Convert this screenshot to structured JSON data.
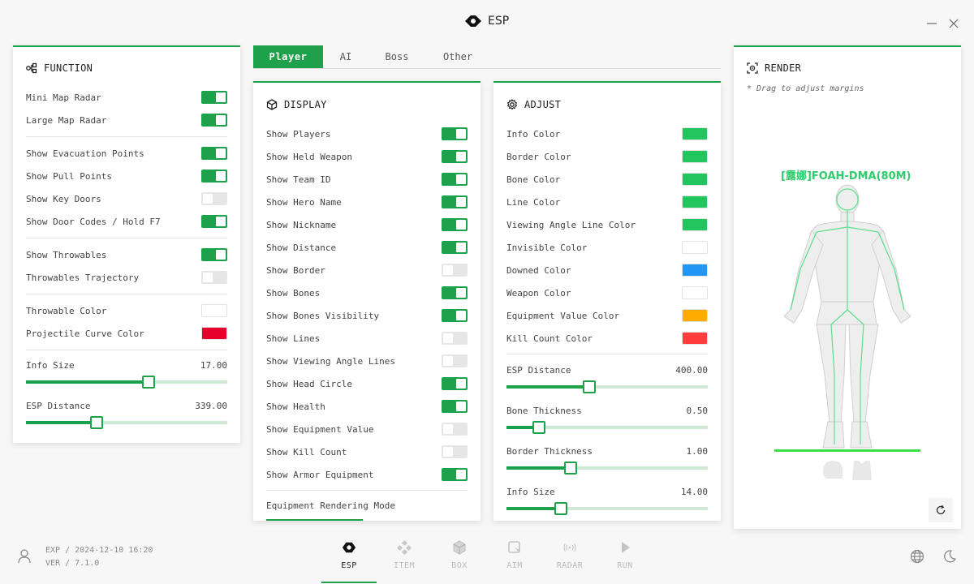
{
  "window": {
    "title": "ESP",
    "minimize_icon": "minimize-icon",
    "close_icon": "close-icon"
  },
  "colors": {
    "accent": "#1da14a",
    "track": "#cfe9d6",
    "toggle_off": "#e6e6e6"
  },
  "function_panel": {
    "title": "FUNCTION",
    "rows": [
      {
        "label": "Mini Map Radar",
        "type": "toggle",
        "on": true
      },
      {
        "label": "Large Map Radar",
        "type": "toggle",
        "on": true
      },
      {
        "label": "Show Evacuation Points",
        "type": "toggle",
        "on": true
      },
      {
        "label": "Show Pull Points",
        "type": "toggle",
        "on": true
      },
      {
        "label": "Show Key Doors",
        "type": "toggle",
        "on": false
      },
      {
        "label": "Show Door Codes / Hold F7",
        "type": "toggle",
        "on": true
      },
      {
        "label": "Show Throwables",
        "type": "toggle",
        "on": true
      },
      {
        "label": "Throwables Trajectory",
        "type": "toggle",
        "on": false
      },
      {
        "label": "Throwable Color",
        "type": "color",
        "color": "#ffffff"
      },
      {
        "label": "Projectile Curve Color",
        "type": "color",
        "color": "#e8002d"
      }
    ],
    "sliders": [
      {
        "label": "Info Size",
        "value": "17.00",
        "fraction": 0.61
      },
      {
        "label": "ESP Distance",
        "value": "339.00",
        "fraction": 0.35
      }
    ]
  },
  "tabs": [
    {
      "label": "Player",
      "active": true
    },
    {
      "label": "AI",
      "active": false
    },
    {
      "label": "Boss",
      "active": false
    },
    {
      "label": "Other",
      "active": false
    }
  ],
  "display_panel": {
    "title": "DISPLAY",
    "rows": [
      {
        "label": "Show Players",
        "on": true
      },
      {
        "label": "Show Held Weapon",
        "on": true
      },
      {
        "label": "Show Team ID",
        "on": true
      },
      {
        "label": "Show Hero Name",
        "on": true
      },
      {
        "label": "Show Nickname",
        "on": true
      },
      {
        "label": "Show Distance",
        "on": true
      },
      {
        "label": "Show Border",
        "on": false
      },
      {
        "label": "Show Bones",
        "on": true
      },
      {
        "label": "Show Bones Visibility",
        "on": true
      },
      {
        "label": "Show Lines",
        "on": false
      },
      {
        "label": "Show Viewing Angle Lines",
        "on": false
      },
      {
        "label": "Show Head Circle",
        "on": true
      },
      {
        "label": "Show Health",
        "on": true
      },
      {
        "label": "Show Equipment Value",
        "on": false
      },
      {
        "label": "Show Kill Count",
        "on": false
      },
      {
        "label": "Show Armor Equipment",
        "on": true
      }
    ],
    "mode_label": "Equipment Rendering Mode"
  },
  "adjust_panel": {
    "title": "ADJUST",
    "colors": [
      {
        "label": "Info Color",
        "color": "#22c55e"
      },
      {
        "label": "Border Color",
        "color": "#22c55e"
      },
      {
        "label": "Bone Color",
        "color": "#22c55e"
      },
      {
        "label": "Line Color",
        "color": "#22c55e"
      },
      {
        "label": "Viewing Angle Line Color",
        "color": "#22c55e"
      },
      {
        "label": "Invisible Color",
        "color": "#ffffff"
      },
      {
        "label": "Downed Color",
        "color": "#2196f3"
      },
      {
        "label": "Weapon Color",
        "color": "#ffffff"
      },
      {
        "label": "Equipment Value Color",
        "color": "#ffab00"
      },
      {
        "label": "Kill Count Color",
        "color": "#ff3d3d"
      }
    ],
    "sliders": [
      {
        "label": "ESP Distance",
        "value": "400.00",
        "fraction": 0.41
      },
      {
        "label": "Bone Thickness",
        "value": "0.50",
        "fraction": 0.16
      },
      {
        "label": "Border Thickness",
        "value": "1.00",
        "fraction": 0.32
      },
      {
        "label": "Info Size",
        "value": "14.00",
        "fraction": 0.27
      }
    ]
  },
  "render_panel": {
    "title": "RENDER",
    "hint": "* Drag to adjust margins",
    "player_label": "[露娜]FOAH-DMA(80M)"
  },
  "status": {
    "line1": "EXP / 2024-12-10 16:20",
    "line2": "VER / 7.1.0"
  },
  "nav": [
    {
      "label": "ESP",
      "icon": "esp-icon",
      "active": true
    },
    {
      "label": "ITEM",
      "icon": "item-icon",
      "active": false
    },
    {
      "label": "BOX",
      "icon": "box-icon",
      "active": false
    },
    {
      "label": "AIM",
      "icon": "aim-icon",
      "active": false
    },
    {
      "label": "RADAR",
      "icon": "radar-icon",
      "active": false
    },
    {
      "label": "RUN",
      "icon": "run-icon",
      "active": false
    }
  ]
}
